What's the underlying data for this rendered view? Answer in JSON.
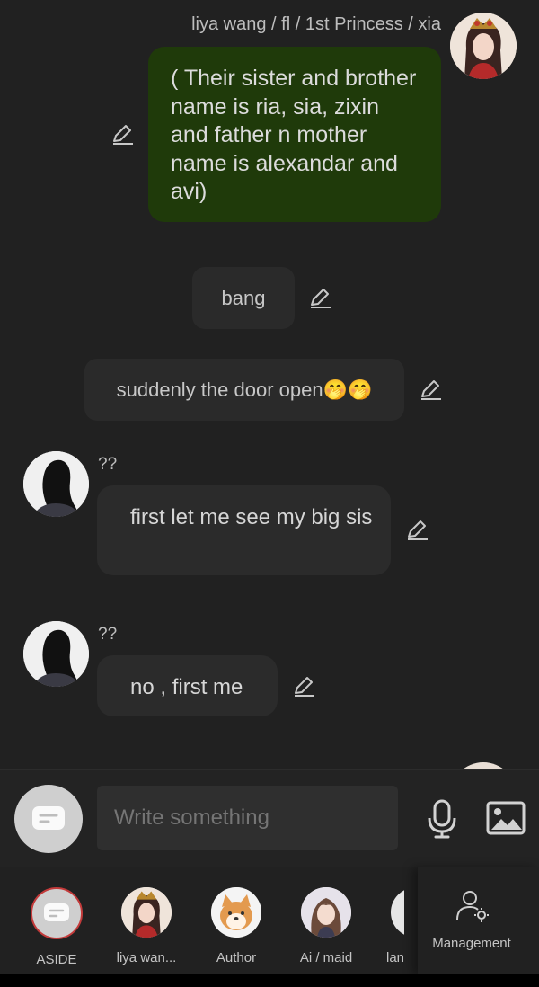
{
  "messages": [
    {
      "sender": "liya wang / fl / 1st Princess / xia",
      "text": "( Their  sister and brother name is ria, sia, zixin and father n mother name is alexandar and avi)"
    },
    {
      "text": "bang"
    },
    {
      "text": "suddenly the door open🤭🤭"
    },
    {
      "sender": "??",
      "text": "first let me see my big sis"
    },
    {
      "sender": "??",
      "text": "no , first me"
    }
  ],
  "input": {
    "placeholder": "Write something"
  },
  "characters": [
    {
      "label": "ASIDE"
    },
    {
      "label": "liya wan..."
    },
    {
      "label": "Author"
    },
    {
      "label": "Ai / maid"
    },
    {
      "label": "lan"
    }
  ],
  "management": {
    "label": "Management"
  },
  "colors": {
    "background": "#212121",
    "own_bubble": "#1f3a0a",
    "bubble": "#2b2b2b",
    "aside_ring": "#c33a3a"
  }
}
